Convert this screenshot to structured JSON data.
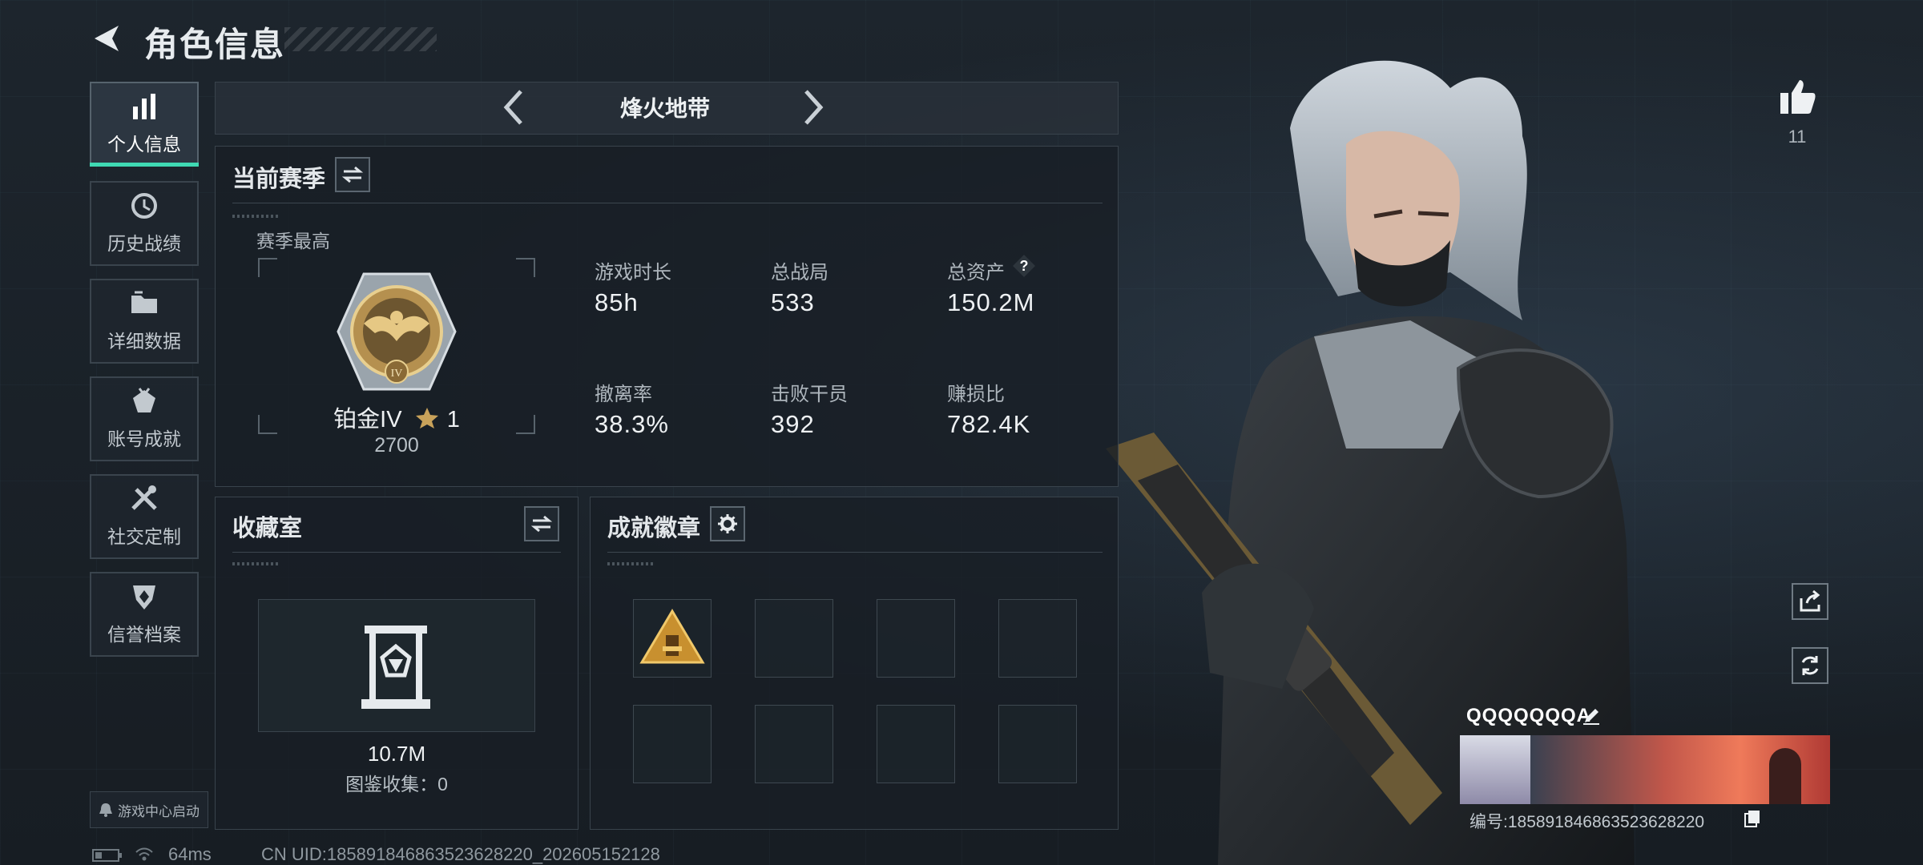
{
  "header": {
    "title": "角色信息"
  },
  "sidebar": {
    "items": [
      {
        "label": "个人信息",
        "icon": "bar-chart-icon",
        "active": true
      },
      {
        "label": "历史战绩",
        "icon": "history-clock-icon",
        "active": false
      },
      {
        "label": "详细数据",
        "icon": "folder-icon",
        "active": false
      },
      {
        "label": "账号成就",
        "icon": "achievement-icon",
        "active": false
      },
      {
        "label": "社交定制",
        "icon": "tools-icon",
        "active": false
      },
      {
        "label": "信誉档案",
        "icon": "shield-icon",
        "active": false
      }
    ],
    "launch_label": "游戏中心启动"
  },
  "mode": {
    "title": "烽火地带"
  },
  "season": {
    "title": "当前赛季",
    "best_label": "赛季最高",
    "rank_name": "铂金IV",
    "rank_stars": "1",
    "rank_score": "2700",
    "rank_badge_numeral": "IV",
    "stats": [
      {
        "label": "游戏时长",
        "value": "85h"
      },
      {
        "label": "总战局",
        "value": "533"
      },
      {
        "label": "总资产",
        "value": "150.2M",
        "help": "?"
      },
      {
        "label": "撤离率",
        "value": "38.3%"
      },
      {
        "label": "击败干员",
        "value": "392"
      },
      {
        "label": "赚损比",
        "value": "782.4K"
      }
    ]
  },
  "collection": {
    "title": "收藏室",
    "value": "10.7M",
    "subtitle": "图鉴收集：0"
  },
  "achievements": {
    "title": "成就徽章",
    "slots": 8,
    "filled": 1
  },
  "likes": {
    "count": "11"
  },
  "player": {
    "name": "QQQQQQQA",
    "id_text": "编号:185891846863523628220"
  },
  "status_bar": {
    "ping": "64ms",
    "uid": "CN UID:185891846863523628220_202605152128"
  },
  "colors": {
    "accent": "#3fd9b3",
    "background": "#1a2128",
    "panel_border": "#39434c"
  }
}
